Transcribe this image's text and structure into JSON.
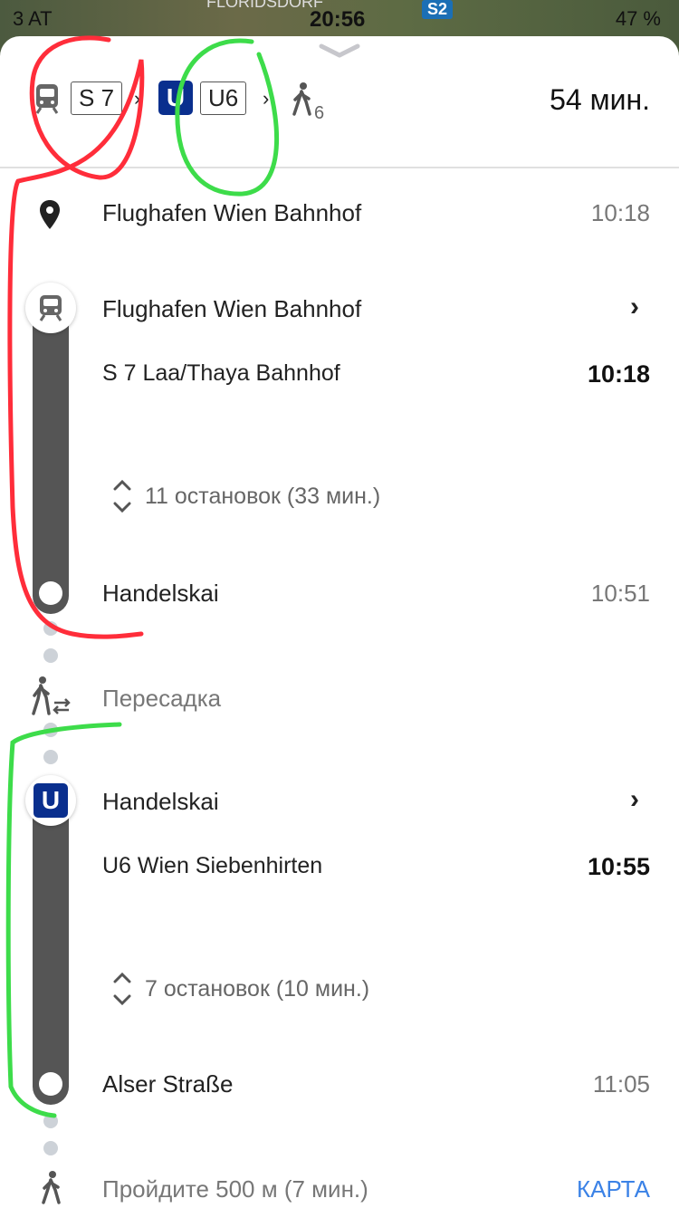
{
  "status": {
    "carrier": "3 AT",
    "time": "20:56",
    "battery": "47 %",
    "map_label": "FLORIDSDORF",
    "map_badge": "S2"
  },
  "summary": {
    "train_chip": "S 7",
    "subway_badge": "U",
    "subway_chip": "U6",
    "walk_count": "6",
    "duration": "54 мин."
  },
  "itinerary": {
    "origin": {
      "name": "Flughafen Wien Bahnhof",
      "time": "10:18"
    },
    "leg1": {
      "board_stop": "Flughafen Wien Bahnhof",
      "route": "S 7 Laa/Thaya Bahnhof",
      "depart_time": "10:18",
      "stops_summary": "11 остановок (33 мин.)",
      "alight_stop": "Handelskai",
      "alight_time": "10:51"
    },
    "transfer_label": "Пересадка",
    "leg2": {
      "badge": "U",
      "board_stop": "Handelskai",
      "route": "U6 Wien Siebenhirten",
      "depart_time": "10:55",
      "stops_summary": "7 остановок (10 мин.)",
      "alight_stop": "Alser Straße",
      "alight_time": "11:05"
    },
    "walk": {
      "label": "Пройдите 500 м (7 мин.)",
      "map_link": "КАРТА"
    }
  },
  "colors": {
    "line_bar": "#555555",
    "subway_blue": "#0a2f8e",
    "link_blue": "#3b82e6",
    "annot_red": "#ff2d3a",
    "annot_green": "#3ddc4a"
  }
}
